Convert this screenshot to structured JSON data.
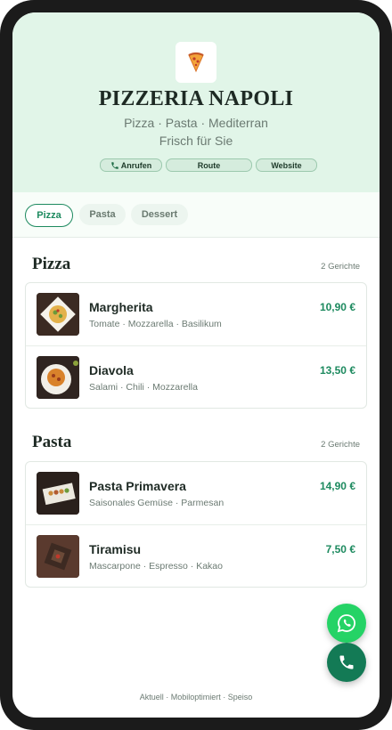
{
  "restaurant": {
    "name": "PIZZERIA NAPOLI",
    "subtitle": "Pizza · Pasta · Mediterran",
    "tagline": "Frisch für Sie"
  },
  "actions": [
    {
      "label": "Anrufen",
      "icon": "phone-icon"
    },
    {
      "label": "Route"
    },
    {
      "label": "Website"
    }
  ],
  "tabs": [
    {
      "label": "Pizza",
      "active": true
    },
    {
      "label": "Pasta",
      "active": false
    },
    {
      "label": "Dessert",
      "active": false
    }
  ],
  "sections": [
    {
      "title": "Pizza",
      "count": "2 Gerichte",
      "items": [
        {
          "name": "Margherita",
          "description": "Tomate · Mozzarella · Basilikum",
          "price": "10,90 €"
        },
        {
          "name": "Diavola",
          "description": "Salami · Chili · Mozzarella",
          "price": "13,50 €"
        }
      ]
    },
    {
      "title": "Pasta",
      "count": "2 Gerichte",
      "items": [
        {
          "name": "Pasta Primavera",
          "description": "Saisonales Gemüse · Parmesan",
          "price": "14,90 €"
        },
        {
          "name": "Tiramisu",
          "description": "Mascarpone · Espresso · Kakao",
          "price": "7,50 €"
        }
      ]
    }
  ],
  "fabs": [
    {
      "icon": "whatsapp-icon"
    },
    {
      "icon": "phone-icon"
    }
  ],
  "footer": "Aktuell · Mobiloptimiert · Speiso",
  "colors": {
    "accent": "#1d8a5f",
    "header_bg": "#e1f5e8",
    "whatsapp": "#25d366"
  }
}
